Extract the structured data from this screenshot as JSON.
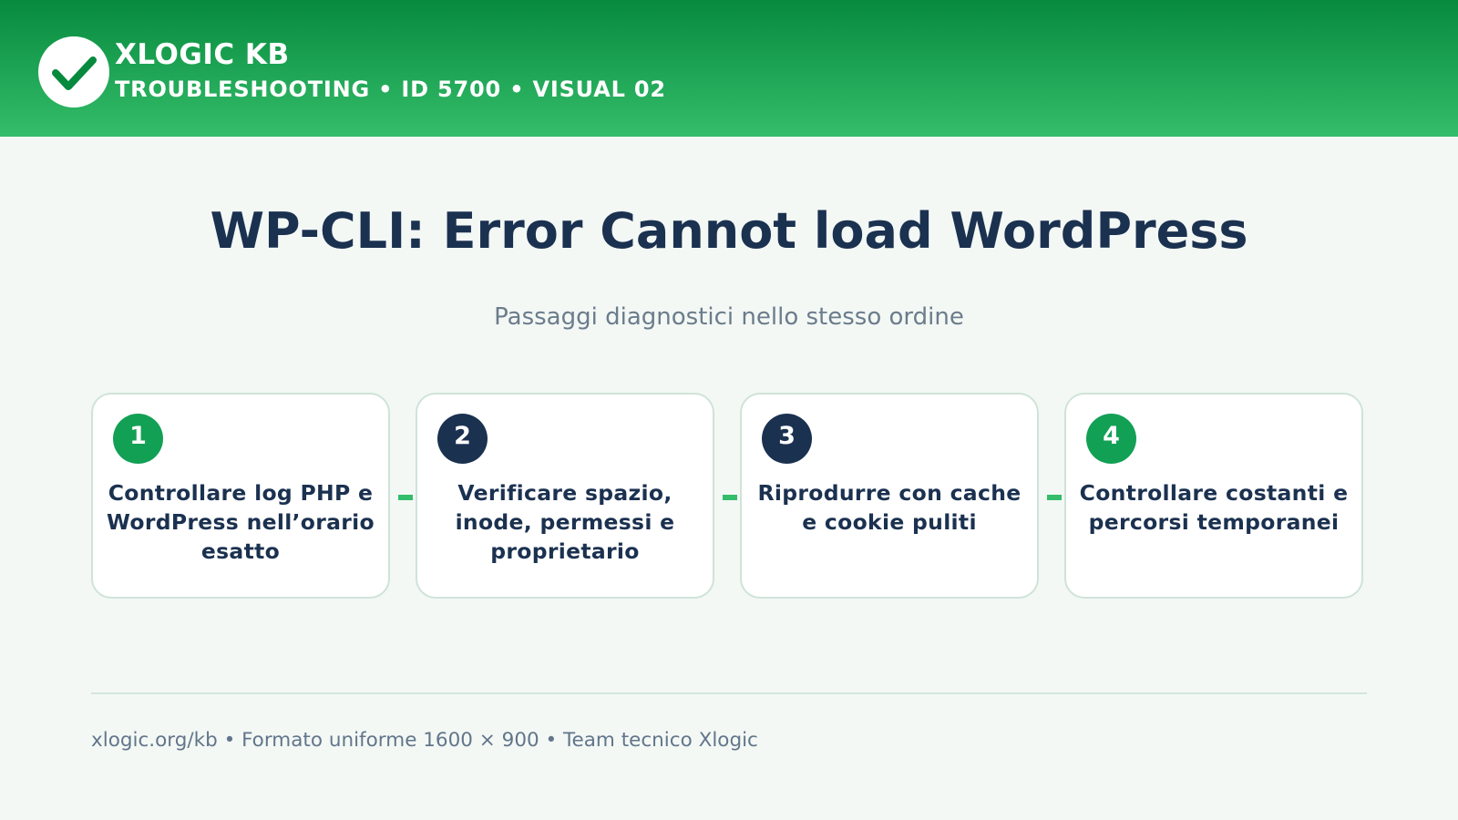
{
  "header": {
    "brand": "XLOGIC KB",
    "subtitle": "TROUBLESHOOTING • ID 5700 • VISUAL 02",
    "logo_icon": "checkmark-icon",
    "colors": {
      "gradient_top": "#078a3e",
      "gradient_bottom": "#34bd6a"
    }
  },
  "title": "WP-CLI: Error Cannot load WordPress",
  "subtitle": "Passaggi diagnostici nello stesso ordine",
  "steps": [
    {
      "number": "1",
      "text": "Controllare log PHP e WordPress nell’orario esatto",
      "color": "#12a055"
    },
    {
      "number": "2",
      "text": "Verificare spazio, inode, permessi e proprietario",
      "color": "#1b3150"
    },
    {
      "number": "3",
      "text": "Riprodurre con cache e cookie puliti",
      "color": "#1b3150"
    },
    {
      "number": "4",
      "text": "Controllare costanti e percorsi temporanei",
      "color": "#12a055"
    }
  ],
  "footer": "xlogic.org/kb • Formato uniforme 1600 × 900 • Team tecnico Xlogic"
}
